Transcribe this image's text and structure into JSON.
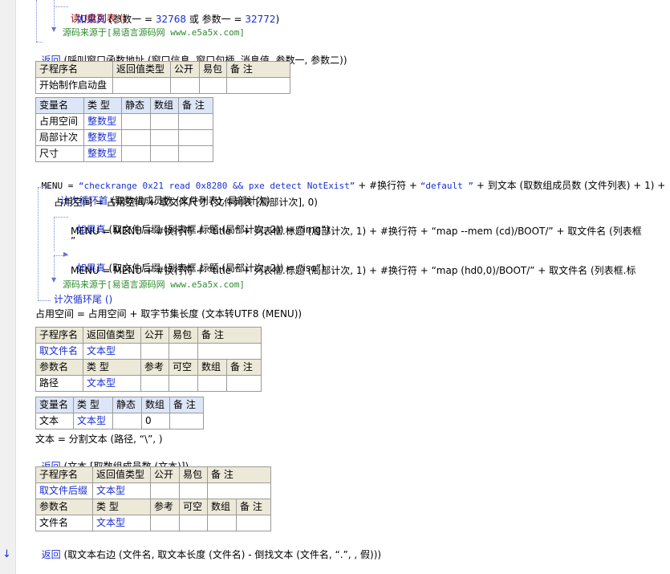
{
  "gutter": {
    "arrow": "↓"
  },
  "block1": {
    "l1_kw": "如果真",
    "l1_rest": " (参数一 = ",
    "l1_n1": "32768",
    "l1_or": " 或 参数一 = ",
    "l1_n2": "32772",
    "l1_end": ")",
    "l2": "读U盘列表 ()",
    "l3": "源码来源于[易语言源码网 www.e5a5x.com]",
    "l4_kw": "返回",
    "l4_rest": " (呼叫窗口函数地址 (窗口信息, 窗口句柄, 消息值, 参数一, 参数二))"
  },
  "sub1": {
    "headers": [
      "子程序名",
      "返回值类型",
      "公开",
      "易包",
      "备 注"
    ],
    "row": [
      "开始制作启动盘",
      "",
      "",
      "",
      ""
    ]
  },
  "vars1": {
    "headers": [
      "变量名",
      "类 型",
      "静态",
      "数组",
      "备 注"
    ],
    "rows": [
      [
        "占用空间",
        "整数型",
        "",
        "",
        ""
      ],
      [
        "局部计次",
        "整数型",
        "",
        "",
        ""
      ],
      [
        "尺寸",
        "整数型",
        "",
        "",
        ""
      ]
    ]
  },
  "code2": {
    "menu_line_a": "MENU = ",
    "menu_str1": "“checkrange 0x21 read 0x8280 && pxe detect NotExist”",
    "menu_line_b": " + #换行符 + ",
    "menu_str2": "“default ”",
    "menu_line_c": " + 到文本 (取数组成员数 (文件列表) + 1) +",
    "loop_kw": "计次循环首",
    "loop_rest": " (取数组成员数 (文件列表), 局部计次)",
    "occ_line": "占用空间 = 占用空间 + 取文件尺寸 (文件列表 [局部计次], 0)",
    "if1_kw": "如果真",
    "if1_rest": " (取文件后缀 (列表框.标题 (局部计次, 2)) = “img”)",
    "if1_body": "MENU = MENU + #换行符 + “title ” + 列表框.标题 (局部计次, 1) + #换行符 + “map --mem (cd)/BOOT/” + 取文件名 (列表框",
    "if1_cont": "”",
    "if2_kw": "如果真",
    "if2_rest": " (取文件后缀 (列表框.标题 (局部计次, 2)) = “iso”)",
    "if2_body": "MENU = MENU + #换行符 + “title ” + 列表框.标题 (局部计次, 1) + #换行符 + “map (hd0,0)/BOOT/” + 取文件名 (列表框.标",
    "src_comment": "源码来源于[易语言源码网 www.e5a5x.com]",
    "loop_end": "计次循环尾 ()",
    "occ2": "占用空间 = 占用空间 + 取字节集长度 (文本转UTF8 (MENU))"
  },
  "sub2": {
    "headers": [
      "子程序名",
      "返回值类型",
      "公开",
      "易包",
      "备 注"
    ],
    "row": [
      "取文件名",
      "文本型",
      "",
      "",
      ""
    ],
    "param_headers": [
      "参数名",
      "类 型",
      "参考",
      "可空",
      "数组",
      "备 注"
    ],
    "param_row": [
      "路径",
      "文本型",
      "",
      "",
      "",
      ""
    ]
  },
  "vars2": {
    "headers": [
      "变量名",
      "类 型",
      "静态",
      "数组",
      "备 注"
    ],
    "row": [
      "文本",
      "文本型",
      "",
      "0",
      ""
    ]
  },
  "code3": {
    "split_line": "文本 = 分割文本 (路径, “\\”, )",
    "ret_kw": "返回",
    "ret_rest": " (文本 [取数组成员数 (文本)])"
  },
  "sub3": {
    "headers": [
      "子程序名",
      "返回值类型",
      "公开",
      "易包",
      "备 注"
    ],
    "row": [
      "取文件后缀",
      "文本型",
      "",
      "",
      ""
    ],
    "param_headers": [
      "参数名",
      "类 型",
      "参考",
      "可空",
      "数组",
      "备 注"
    ],
    "param_row": [
      "文件名",
      "文本型",
      "",
      "",
      "",
      ""
    ]
  },
  "code4": {
    "ret_kw": "返回",
    "ret_rest": " (取文本右边 (文件名, 取文本长度 (文件名) - 倒找文本 (文件名, “.”, , 假)))"
  }
}
